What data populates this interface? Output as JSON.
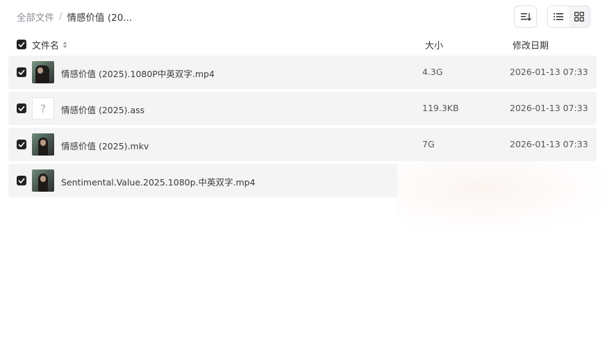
{
  "breadcrumb": {
    "root": "全部文件",
    "separator": "/",
    "current": "情感价值 (20..."
  },
  "table_header": {
    "name": "文件名",
    "size": "大小",
    "date": "修改日期"
  },
  "files": [
    {
      "name": "情感价值 (2025).1080P中英双字.mp4",
      "size": "4.3G",
      "date": "2026-01-13 07:33",
      "thumb": "video-thumbnail"
    },
    {
      "name": "情感价值 (2025).ass",
      "size": "119.3KB",
      "date": "2026-01-13 07:33",
      "thumb": "unknown-file-icon",
      "glyph": "?"
    },
    {
      "name": "情感价值 (2025).mkv",
      "size": "7G",
      "date": "2026-01-13 07:33",
      "thumb": "video-thumbnail"
    },
    {
      "name": "Sentimental.Value.2025.1080p.中英双字.mp4",
      "size": "",
      "date": "",
      "thumb": "video-thumbnail"
    }
  ],
  "icons": {
    "sort": "sort-icon",
    "list_view": "list-view-icon",
    "grid_view": "grid-view-icon",
    "checkbox": "check-icon"
  }
}
